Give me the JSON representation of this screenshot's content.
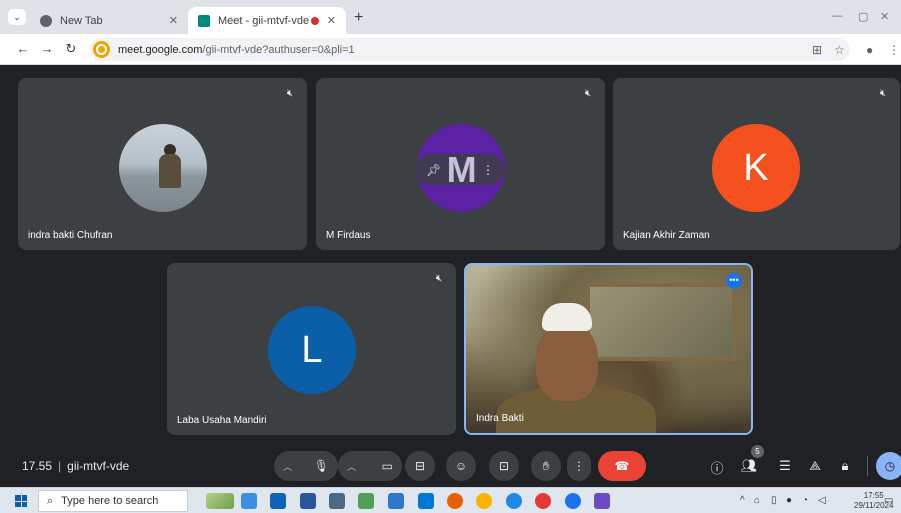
{
  "browser": {
    "tabs": [
      {
        "title": "New Tab",
        "active": false,
        "favicon_color": "#5f6368"
      },
      {
        "title": "Meet - gii-mtvf-vde",
        "active": true,
        "favicon_color": "#00897b"
      }
    ],
    "url_host": "meet.google.com",
    "url_path": "/gii-mtvf-vde?authuser=0&pli=1"
  },
  "meeting": {
    "time": "17.55",
    "code": "gii-mtvf-vde",
    "participant_count": "5",
    "tiles": [
      {
        "name": "indra bakti Chufran",
        "type": "photo",
        "muted": true
      },
      {
        "name": "M Firdaus",
        "type": "initial",
        "initial": "M",
        "color": "#5b22a6",
        "muted": true
      },
      {
        "name": "Kajian Akhir Zaman",
        "type": "initial",
        "initial": "K",
        "color": "#f4511e",
        "muted": true
      },
      {
        "name": "Laba Usaha Mandiri",
        "type": "initial",
        "initial": "L",
        "color": "#0b5ea8",
        "muted": true
      },
      {
        "name": "Indra Bakti",
        "type": "video",
        "muted": false
      }
    ]
  },
  "taskbar": {
    "search_placeholder": "Type here to search",
    "clock_time": "17:55",
    "clock_date": "29/11/2024"
  },
  "colors": {
    "end_call": "#ea4335",
    "accent": "#8ab4f8",
    "tile_bg": "#3c4043",
    "stage_bg": "#202124"
  }
}
